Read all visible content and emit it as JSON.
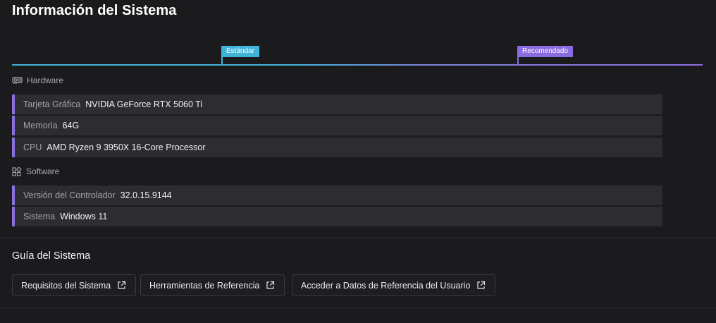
{
  "page": {
    "title": "Información del Sistema"
  },
  "tiers": {
    "standard_label": "Estándar",
    "recommended_label": "Recomendado",
    "colors": {
      "standard": "#3fb4d8",
      "recommended": "#8b6ce0"
    }
  },
  "hardware": {
    "header": "Hardware",
    "icon": "gpu-card-icon",
    "rows": [
      {
        "label": "Tarjeta Gráfica",
        "value": "NVIDIA GeForce RTX 5060 Ti"
      },
      {
        "label": "Memoria",
        "value": "64G"
      },
      {
        "label": "CPU",
        "value": "AMD Ryzen 9 3950X 16-Core Processor"
      }
    ]
  },
  "software": {
    "header": "Software",
    "icon": "software-grid-icon",
    "rows": [
      {
        "label": "Versión del Controlador",
        "value": "32.0.15.9144"
      },
      {
        "label": "Sistema",
        "value": "Windows 11"
      }
    ]
  },
  "guide": {
    "title": "Guía del Sistema",
    "links": [
      {
        "label": "Requisitos del Sistema",
        "icon": "external-link-icon"
      },
      {
        "label": "Herramientas de Referencia",
        "icon": "external-link-icon"
      },
      {
        "label": "Acceder a Datos de Referencia del Usuario",
        "icon": "external-link-icon"
      }
    ]
  },
  "accent_color": "#8a6fe0"
}
